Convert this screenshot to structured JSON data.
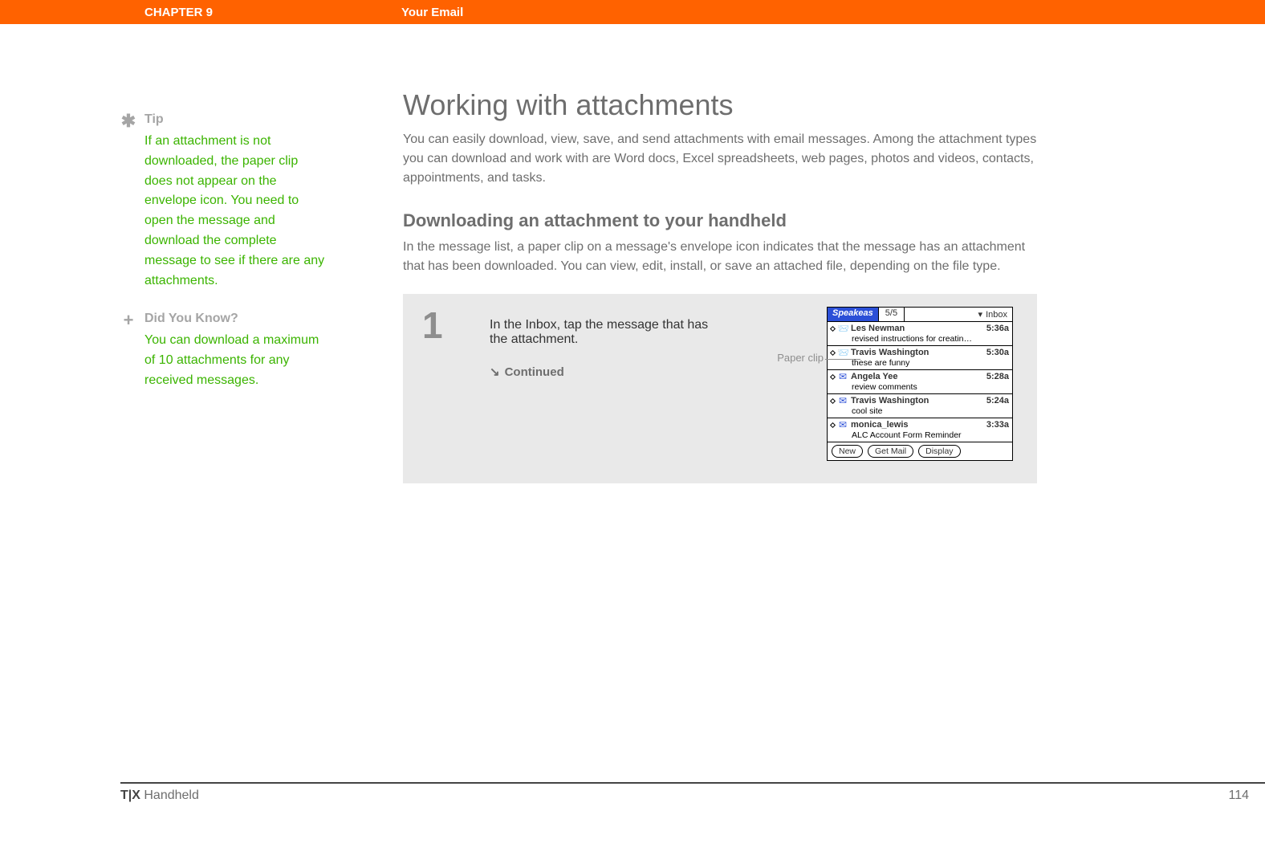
{
  "header": {
    "chapter": "CHAPTER 9",
    "title": "Your Email"
  },
  "sidebar": {
    "tip": {
      "icon": "✱",
      "label": "Tip",
      "body": "If an attachment is not downloaded, the paper clip does not appear on the envelope icon. You need to open the message and download the complete message to see if there are any attachments."
    },
    "dyk": {
      "icon": "+",
      "label": "Did You Know?",
      "body": "You can download a maximum of 10 attachments for any received messages."
    }
  },
  "main": {
    "h1": "Working with attachments",
    "intro": "You can easily download, view, save, and send attachments with email messages. Among the attachment types you can download and work with are Word docs, Excel spreadsheets, web pages, photos and videos, contacts, appointments, and tasks.",
    "h2": "Downloading an attachment to your handheld",
    "subintro": "In the message list, a paper clip on a message's envelope icon indicates that the message has an attachment that has been downloaded. You can view, edit, install, or save an attached file, depending on the file type."
  },
  "step": {
    "number": "1",
    "text": "In the Inbox, tap the message that has the attachment.",
    "continued_arrow": "↘",
    "continued_label": "Continued",
    "callout": "Paper clip"
  },
  "device": {
    "brand": "Speakeas",
    "pager": "5/5",
    "dropdown_arrow": "▾",
    "dropdown": "Inbox",
    "messages": [
      {
        "icon": "📨",
        "sender": "Les Newman",
        "time": "5:36a",
        "subject": "revised instructions for creatin…"
      },
      {
        "icon": "📨",
        "sender": "Travis Washington",
        "time": "5:30a",
        "subject": "these are funny"
      },
      {
        "icon": "✉",
        "sender": "Angela Yee",
        "time": "5:28a",
        "subject": "review comments"
      },
      {
        "icon": "✉",
        "sender": "Travis Washington",
        "time": "5:24a",
        "subject": "cool site"
      },
      {
        "icon": "✉",
        "sender": "monica_lewis",
        "time": "3:33a",
        "subject": "ALC Account Form Reminder"
      }
    ],
    "buttons": {
      "new": "New",
      "get": "Get Mail",
      "display": "Display"
    }
  },
  "footer": {
    "device_bold": "T|X",
    "device_rest": " Handheld",
    "page": "114"
  }
}
